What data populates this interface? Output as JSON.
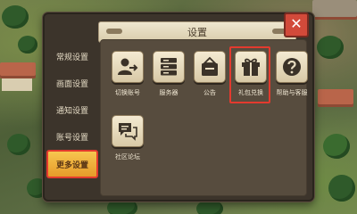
{
  "dialog": {
    "title": "设置",
    "close_symbol": "✕"
  },
  "sidebar": {
    "items": [
      {
        "label": "常规设置",
        "active": false
      },
      {
        "label": "画面设置",
        "active": false
      },
      {
        "label": "通知设置",
        "active": false
      },
      {
        "label": "账号设置",
        "active": false
      },
      {
        "label": "更多设置",
        "active": true
      }
    ]
  },
  "tiles": [
    {
      "label": "切换账号",
      "icon": "switch-account-icon"
    },
    {
      "label": "服务器",
      "icon": "server-icon"
    },
    {
      "label": "公告",
      "icon": "announcement-icon"
    },
    {
      "label": "礼包兑换",
      "icon": "gift-icon",
      "highlighted": true
    },
    {
      "label": "帮助与客服",
      "icon": "help-icon"
    },
    {
      "label": "社区论坛",
      "icon": "forum-icon"
    }
  ],
  "colors": {
    "accent": "#e33a2e",
    "active_tab": "#f0b43e",
    "icon_dark": "#3b3228"
  }
}
